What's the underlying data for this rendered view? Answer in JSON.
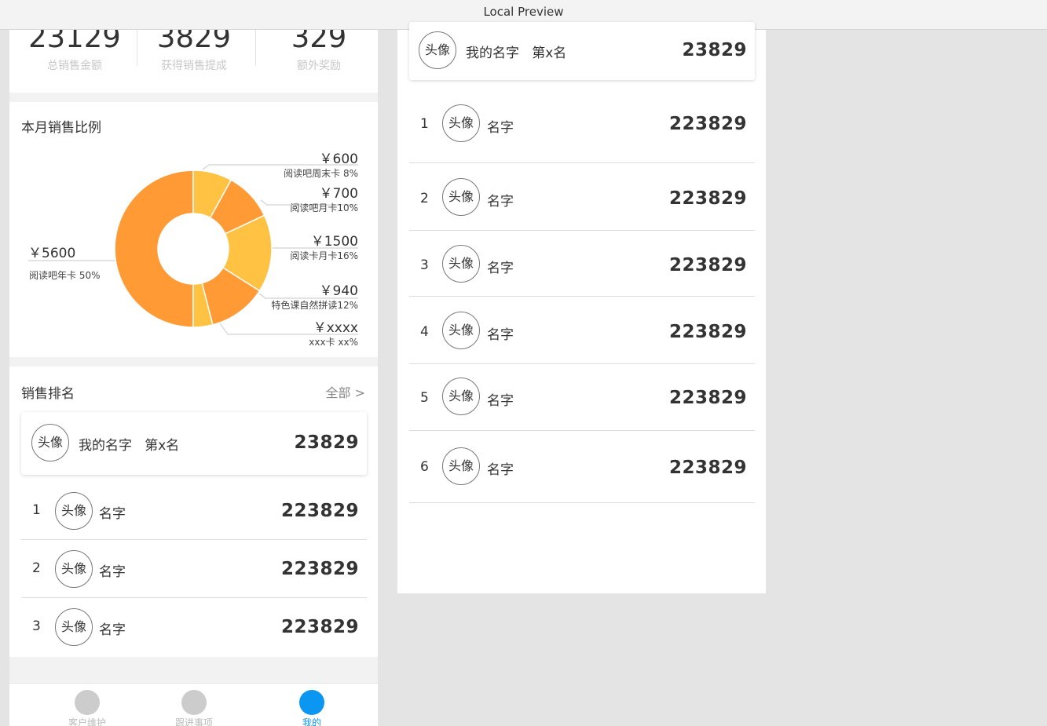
{
  "window": {
    "title": "Local Preview"
  },
  "stats": [
    {
      "value": "23129",
      "label": "总销售金额"
    },
    {
      "value": "3829",
      "label": "获得销售提成"
    },
    {
      "value": "329",
      "label": "额外奖励"
    }
  ],
  "sales_ratio": {
    "title": "本月销售比例",
    "items": [
      {
        "amount": "￥5600",
        "label": "阅读吧年卡 50%"
      },
      {
        "amount": "￥600",
        "label": "阅读吧周末卡 8%"
      },
      {
        "amount": "￥700",
        "label": "阅读吧月卡10%"
      },
      {
        "amount": "￥1500",
        "label": "阅读卡月卡16%"
      },
      {
        "amount": "￥940",
        "label": "特色课自然拼读12%"
      },
      {
        "amount": "￥xxxx",
        "label": "xxx卡 xx%"
      }
    ]
  },
  "chart_data": {
    "type": "pie",
    "title": "本月销售比例",
    "labels": [
      "阅读吧年卡",
      "阅读吧周末卡",
      "阅读吧月卡",
      "阅读卡月卡",
      "特色课自然拼读",
      "xxx卡"
    ],
    "values": [
      50,
      8,
      10,
      16,
      12,
      4
    ],
    "amounts": [
      "￥5600",
      "￥600",
      "￥700",
      "￥1500",
      "￥940",
      "￥xxxx"
    ],
    "colors": [
      "#ff9a35",
      "#ffc242",
      "#ff9a35",
      "#ffc242",
      "#ff9a35",
      "#ffc242"
    ],
    "donut": true
  },
  "ranking": {
    "title": "销售排名",
    "all_label": "全部 >",
    "me": {
      "avatar": "头像",
      "name": "我的名字",
      "rank": "第x名",
      "value": "23829"
    },
    "rows": [
      {
        "idx": "1",
        "avatar": "头像",
        "name": "名字",
        "value": "223829"
      },
      {
        "idx": "2",
        "avatar": "头像",
        "name": "名字",
        "value": "223829"
      },
      {
        "idx": "3",
        "avatar": "头像",
        "name": "名字",
        "value": "223829"
      }
    ]
  },
  "ranking_full": {
    "me": {
      "avatar": "头像",
      "name": "我的名字",
      "rank": "第x名",
      "value": "23829"
    },
    "rows": [
      {
        "idx": "1",
        "avatar": "头像",
        "name": "名字",
        "value": "223829"
      },
      {
        "idx": "2",
        "avatar": "头像",
        "name": "名字",
        "value": "223829"
      },
      {
        "idx": "3",
        "avatar": "头像",
        "name": "名字",
        "value": "223829"
      },
      {
        "idx": "4",
        "avatar": "头像",
        "name": "名字",
        "value": "223829"
      },
      {
        "idx": "5",
        "avatar": "头像",
        "name": "名字",
        "value": "223829"
      },
      {
        "idx": "6",
        "avatar": "头像",
        "name": "名字",
        "value": "223829"
      }
    ]
  },
  "tabs": [
    {
      "label": "客户维护",
      "active": false
    },
    {
      "label": "跟进事项",
      "active": false
    },
    {
      "label": "我的",
      "active": true
    }
  ],
  "colors": {
    "accent": "#0b96f2",
    "orange": "#ff9a35",
    "yellow": "#ffc242"
  }
}
